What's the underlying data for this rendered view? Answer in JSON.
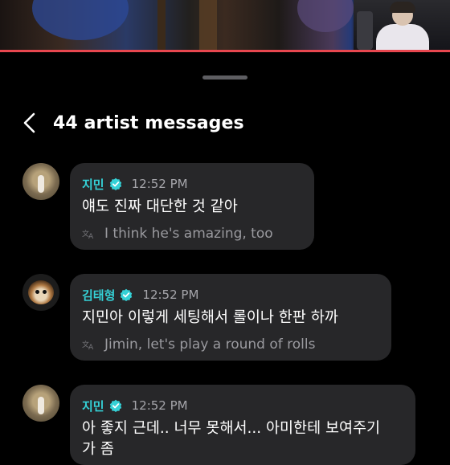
{
  "header": {
    "title": "44 artist messages"
  },
  "messages": [
    {
      "sender": "지민",
      "time": "12:52 PM",
      "text": "얘도 진짜 대단한 것 같아",
      "translation": "I think he's amazing, too"
    },
    {
      "sender": "김태형",
      "time": "12:52 PM",
      "text": "지민아 이렇게 세팅해서 롤이나 한판 하까",
      "translation": "Jimin, let's play a round of rolls"
    },
    {
      "sender": "지민",
      "time": "12:52 PM",
      "text": "아 좋지 근데.. 너무 못해서... 아미한테 보여주기",
      "text_cont": "가 좀"
    }
  ],
  "colors": {
    "sender_name": "#35d1d6",
    "verified_badge": "#35d1d6",
    "bubble": "#272729",
    "video_progress": "#e8474f"
  },
  "icons": {
    "back": "chevron-left-icon",
    "verified": "verified-badge-icon",
    "translate": "translate-icon"
  }
}
